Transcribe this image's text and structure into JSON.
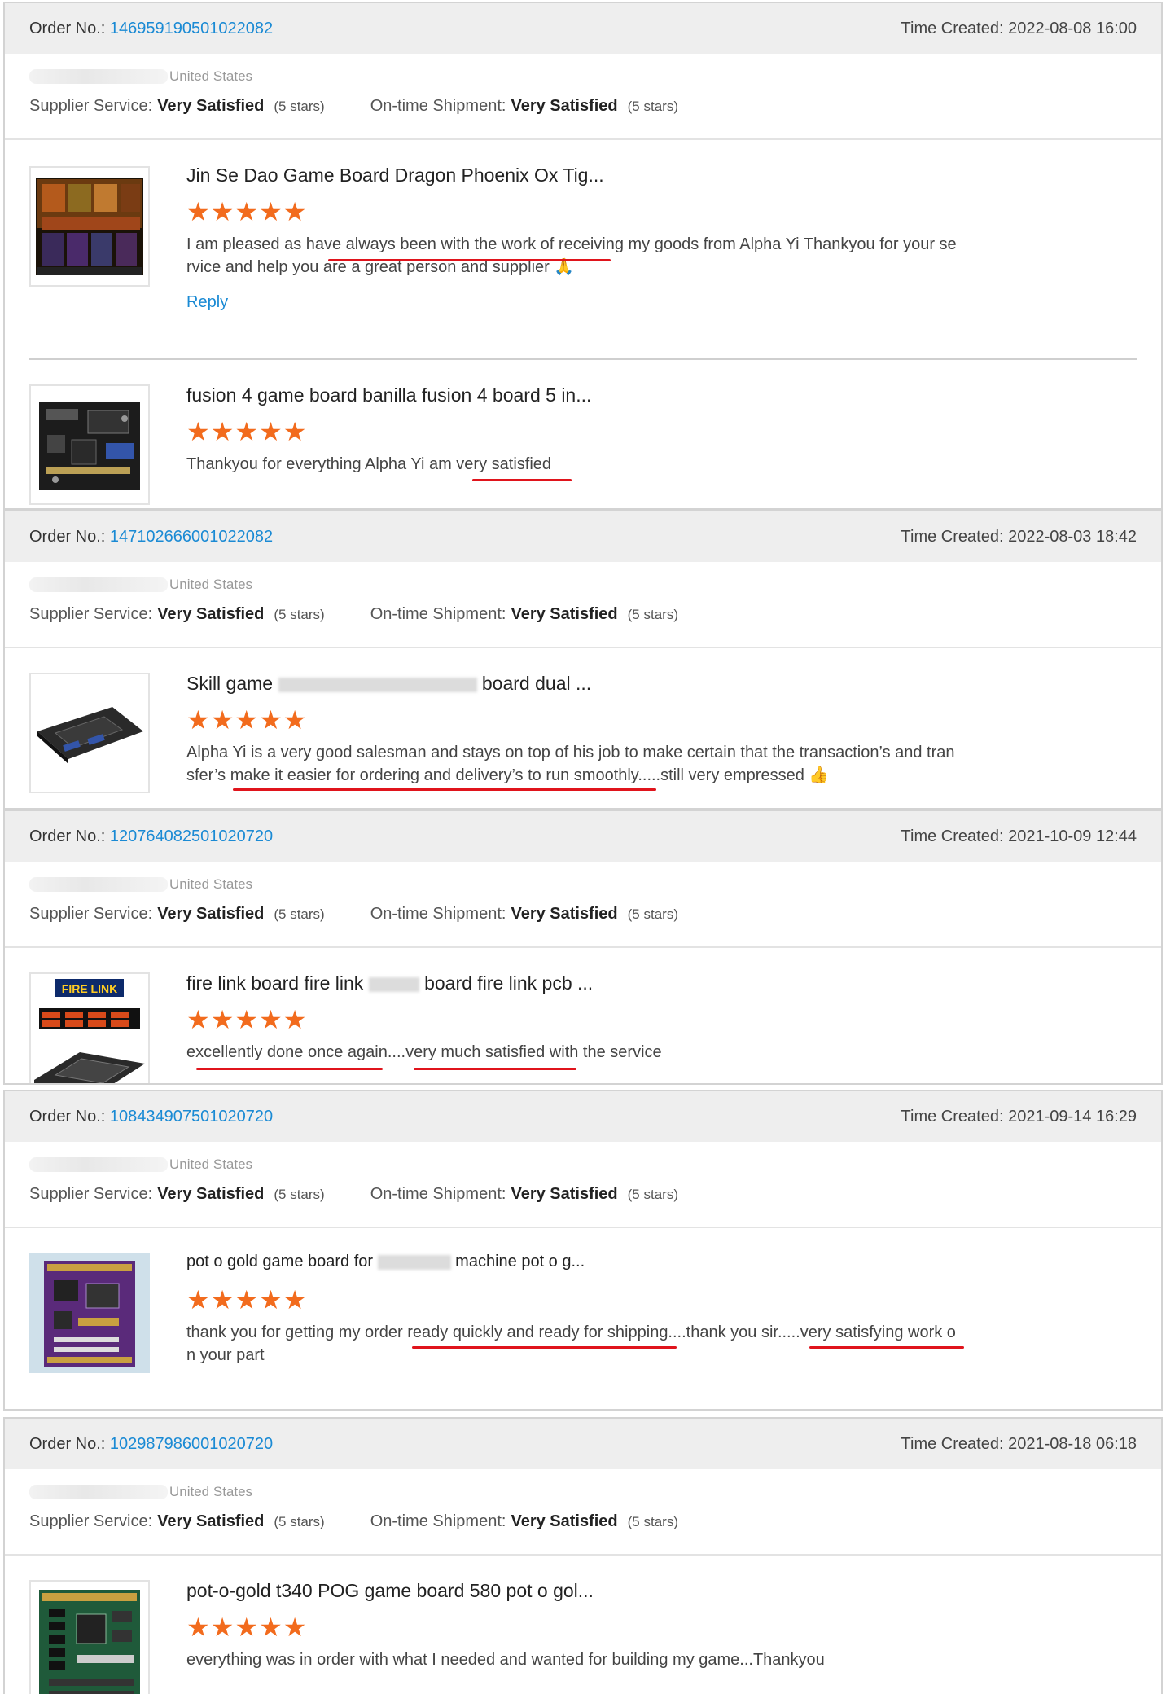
{
  "labels": {
    "order_no": "Order No.:",
    "time_created": "Time Created:",
    "supplier_service": "Supplier Service:",
    "ontime_shipment": "On-time Shipment:",
    "reply": "Reply",
    "star_glyphs": "★★★★★"
  },
  "orders": [
    {
      "order_no": "146959190501022082",
      "time": "2022-08-08 16:00",
      "country": "United States",
      "supplier_service": "Very Satisfied",
      "supplier_stars": "(5 stars)",
      "shipment": "Very Satisfied",
      "shipment_stars": "(5 stars)",
      "products": [
        {
          "title": "Jin Se Dao Game Board Dragon Phoenix Ox Tig...",
          "review_line1": "I am pleased as have always been with the work of receiving my goods from Alpha Yi Thankyou for your se",
          "review_line2": "rvice and help you are a great person and supplier 🙏",
          "has_reply": true
        },
        {
          "title": "fusion 4 game board banilla fusion 4 board 5 in...",
          "review_line1": "Thankyou for everything Alpha Yi am very satisfied",
          "review_line2": "",
          "has_reply": false
        }
      ]
    },
    {
      "order_no": "147102666001022082",
      "time": "2022-08-03 18:42",
      "country": "United States",
      "supplier_service": "Very Satisfied",
      "supplier_stars": "(5 stars)",
      "shipment": "Very Satisfied",
      "shipment_stars": "(5 stars)",
      "products": [
        {
          "title_pre": "Skill game",
          "title_post": "board dual ...",
          "review_line1": "Alpha Yi is a very good salesman and stays on top of his job to make certain that the transaction’s and tran",
          "review_line2": "sfer’s make it easier for ordering and delivery’s to run smoothly.....still very empressed 👍",
          "has_reply": false
        }
      ]
    },
    {
      "order_no": "120764082501020720",
      "time": "2021-10-09 12:44",
      "country": "United States",
      "supplier_service": "Very Satisfied",
      "supplier_stars": "(5 stars)",
      "shipment": "Very Satisfied",
      "shipment_stars": "(5 stars)",
      "products": [
        {
          "title_pre": "fire link board fire link",
          "title_post": "board fire link pcb ...",
          "review_line1": "excellently done once again....very much satisfied with the service",
          "review_line2": "",
          "thumb_text": "FIRE LINK",
          "has_reply": false
        }
      ]
    },
    {
      "order_no": "108434907501020720",
      "time": "2021-09-14 16:29",
      "country": "United States",
      "supplier_service": "Very Satisfied",
      "supplier_stars": "(5 stars)",
      "shipment": "Very Satisfied",
      "shipment_stars": "(5 stars)",
      "products": [
        {
          "title_pre": "pot o gold game board for",
          "title_post": "machine pot o g...",
          "review_line1": "thank you for getting my order ready quickly and ready for shipping....thank you sir.....very satisfying work o",
          "review_line2": "n your part",
          "has_reply": false
        }
      ]
    },
    {
      "order_no": "102987986001020720",
      "time": "2021-08-18 06:18",
      "country": "United States",
      "supplier_service": "Very Satisfied",
      "supplier_stars": "(5 stars)",
      "shipment": "Very Satisfied",
      "shipment_stars": "(5 stars)",
      "products": [
        {
          "title": "pot-o-gold t340 POG game board 580 pot o gol...",
          "review_line1": "everything was in order with what I needed and wanted for building my game...Thankyou",
          "review_line2": "",
          "has_reply": false
        }
      ]
    }
  ],
  "colors": {
    "link_blue": "#1a8ad4",
    "star_orange": "#f26b1d",
    "header_gray": "#eeeeee",
    "annotation_red": "#e0141c"
  }
}
